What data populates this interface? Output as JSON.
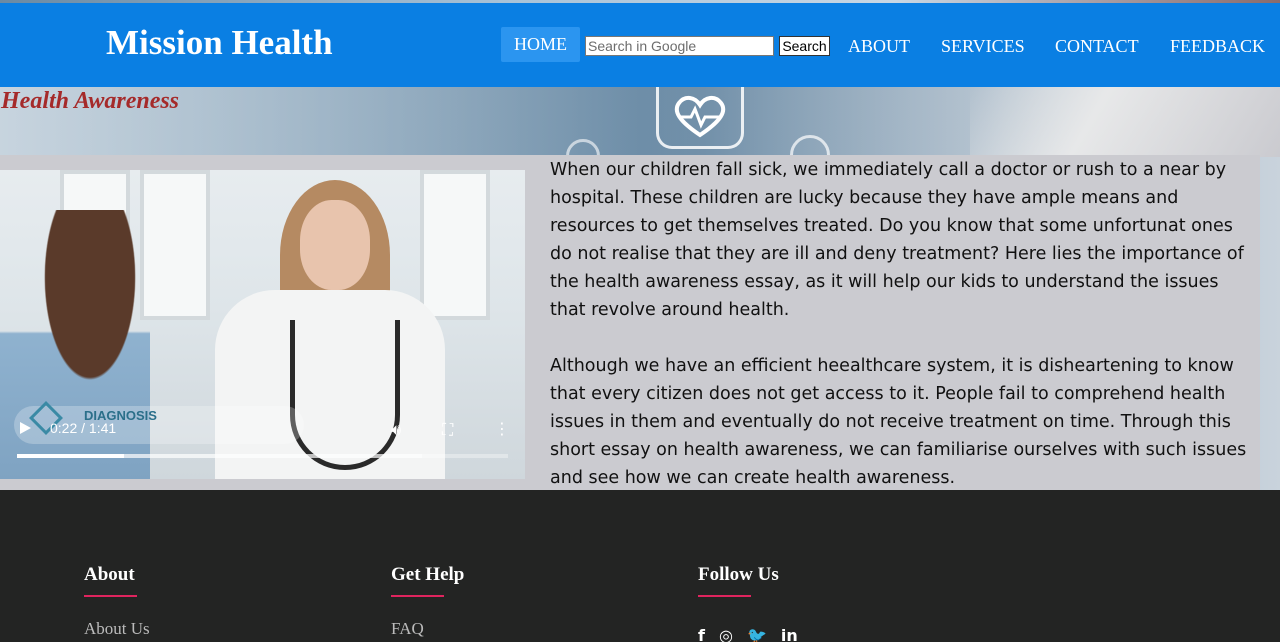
{
  "header": {
    "brand": "Mission Health",
    "nav": {
      "home": "HOME",
      "about": "ABOUT",
      "services": "SERVICES",
      "contact": "CONTACT",
      "feedback": "FEEDBACK"
    },
    "search": {
      "placeholder": "Search in Google",
      "button_label": "Search"
    }
  },
  "hero": {
    "title": "Health Awareness"
  },
  "video": {
    "time": "0:22 / 1:41",
    "progress": 0.2178,
    "buffered": 0.825,
    "overlay_brand": "DIAGNOSIS",
    "icons": {
      "play": "play-icon",
      "volume": "volume-icon",
      "fullscreen": "fullscreen-icon",
      "more": "more-options-icon"
    }
  },
  "article": {
    "paragraphs": [
      "When our children fall sick, we immediately call a doctor or rush to a near by hospital. These children are lucky because they have ample  means and resources to get themselves treated. Do you know that some unfortunat ones do not realise that they are ill and deny treatment? Here lies the importance of the health awareness essay, as it will help our kids to understand the issues that revolve around health.",
      "Although we have an efficient heealthcare system, it is disheartening to know that every citizen does not get access to it. People fail to comprehend health issues in them and eventually do not receive treatment on time. Through this short essay on health awareness, we can familiarise ourselves with such issues and see how we can create health awareness."
    ]
  },
  "footer": {
    "about": {
      "heading": "About",
      "links": [
        "About Us"
      ]
    },
    "help": {
      "heading": "Get Help",
      "links": [
        "FAQ"
      ]
    },
    "follow": {
      "heading": "Follow Us",
      "icons": [
        "facebook-icon",
        "instagram-icon",
        "twitter-icon",
        "linkedin-icon"
      ],
      "glyphs": [
        "f",
        "◎",
        "🐦",
        "in"
      ]
    }
  },
  "colors": {
    "header_bg": "#0a7fe3",
    "hero_title": "#a52a2a",
    "footer_bg": "#232423",
    "footer_accent": "#e0245e"
  }
}
